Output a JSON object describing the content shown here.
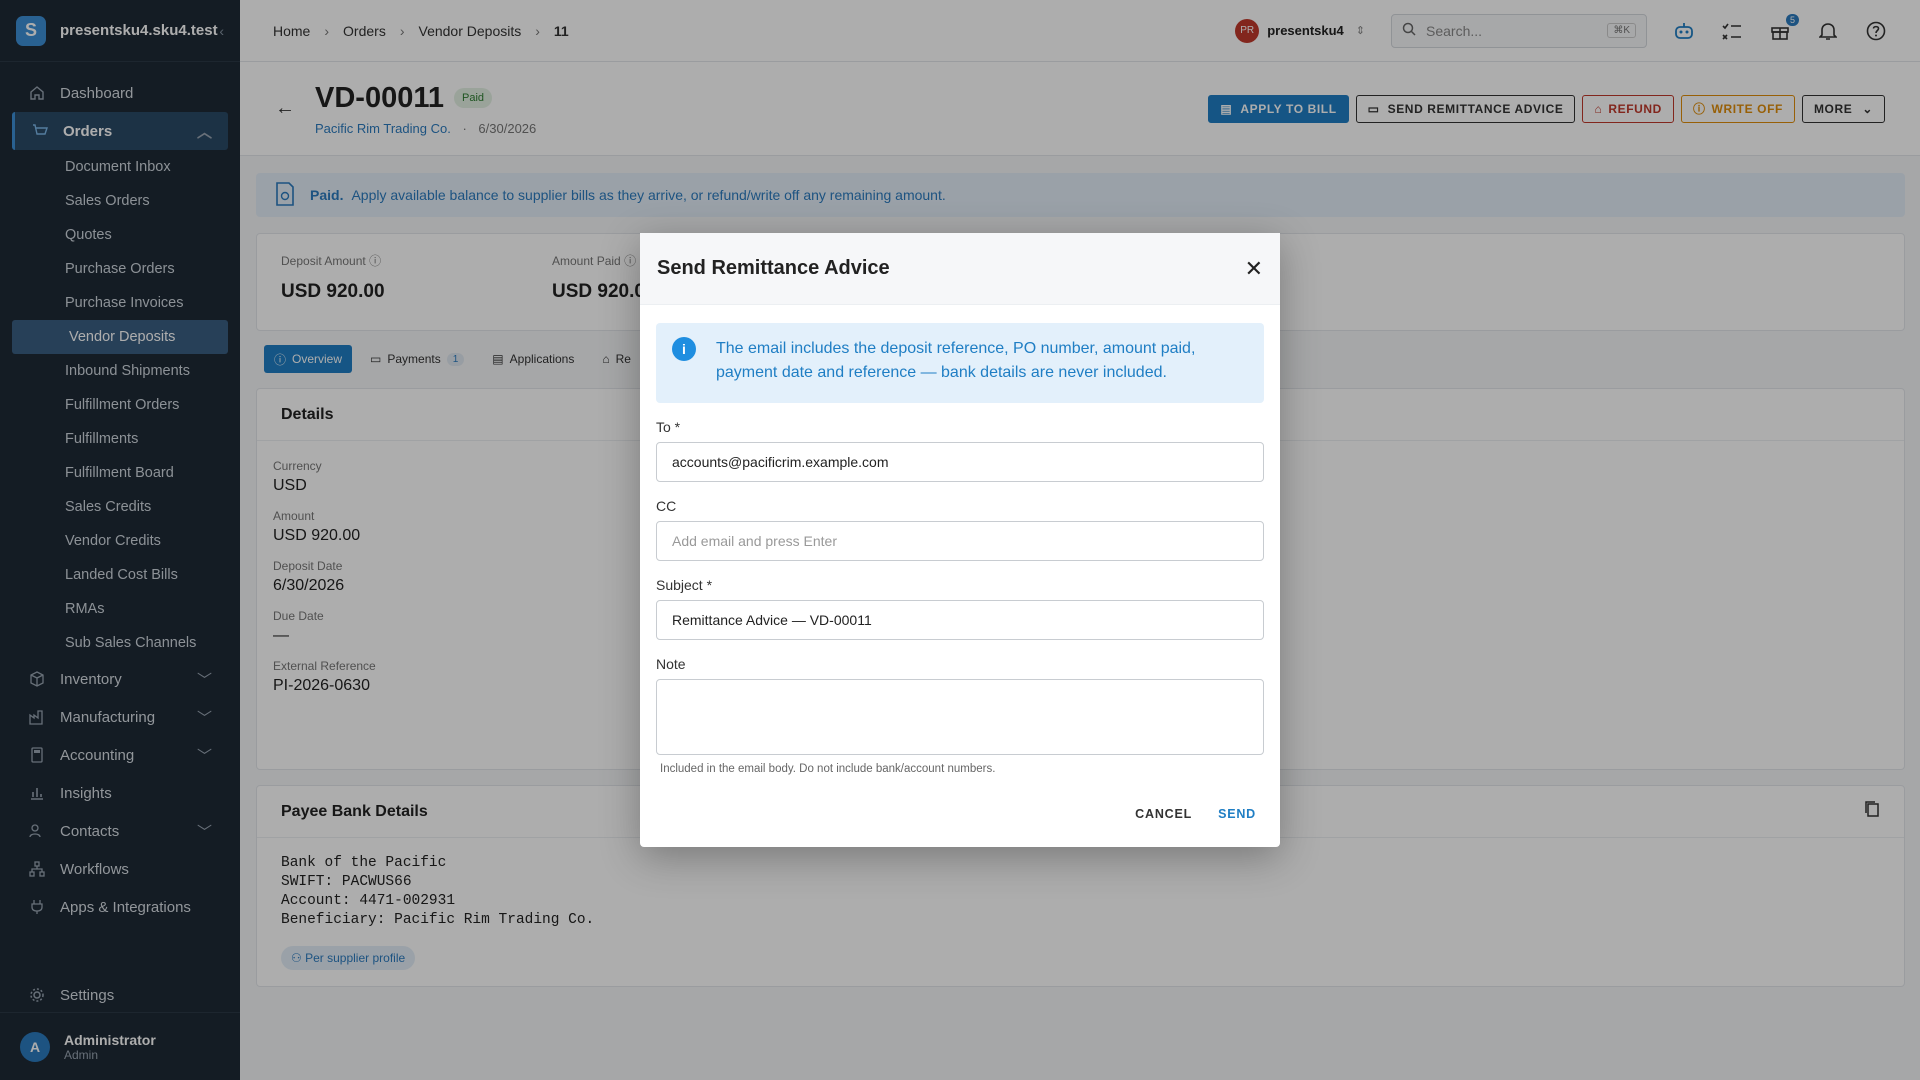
{
  "app": {
    "org": "presentsku4.sku4.test",
    "logo_letter": "S"
  },
  "sidebar": {
    "items": [
      {
        "label": "Dashboard"
      },
      {
        "label": "Orders"
      },
      {
        "label": "Inventory"
      },
      {
        "label": "Manufacturing"
      },
      {
        "label": "Accounting"
      },
      {
        "label": "Insights"
      },
      {
        "label": "Contacts"
      },
      {
        "label": "Workflows"
      },
      {
        "label": "Apps & Integrations"
      }
    ],
    "orders_sub": [
      "Document Inbox",
      "Sales Orders",
      "Quotes",
      "Purchase Orders",
      "Purchase Invoices",
      "Vendor Deposits",
      "Inbound Shipments",
      "Fulfillment Orders",
      "Fulfillments",
      "Fulfillment Board",
      "Sales Credits",
      "Vendor Credits",
      "Landed Cost Bills",
      "RMAs",
      "Sub Sales Channels"
    ],
    "settings": "Settings",
    "user": {
      "initial": "A",
      "name": "Administrator",
      "role": "Admin"
    }
  },
  "topbar": {
    "breadcrumbs": [
      "Home",
      "Orders",
      "Vendor Deposits",
      "11"
    ],
    "org_initials": "PR",
    "org_name": "presentsku4",
    "search_placeholder": "Search...",
    "search_shortcut": "⌘K",
    "gift_badge": "5"
  },
  "header": {
    "title": "VD-00011",
    "status": "Paid",
    "vendor": "Pacific Rim Trading Co.",
    "date": "6/30/2026",
    "actions": {
      "apply": "APPLY TO BILL",
      "remit": "SEND REMITTANCE ADVICE",
      "refund": "REFUND",
      "writeoff": "WRITE OFF",
      "more": "MORE"
    }
  },
  "banner": {
    "strong": "Paid.",
    "text": "Apply available balance to supplier bills as they arrive, or refund/write off any remaining amount."
  },
  "stats": [
    {
      "label": "Deposit Amount",
      "value": "USD 920.00"
    },
    {
      "label": "Amount Paid",
      "value": "USD 920.00"
    }
  ],
  "tabs": {
    "overview": "Overview",
    "payments": "Payments",
    "payments_count": "1",
    "applications": "Applications",
    "refunds": "Re"
  },
  "details": {
    "title": "Details",
    "fields": [
      {
        "label": "Currency",
        "value": "USD"
      },
      {
        "label": "Amount",
        "value": "USD 920.00"
      },
      {
        "label": "Deposit Date",
        "value": "6/30/2026"
      },
      {
        "label": "Due Date",
        "value": "—"
      },
      {
        "label": "External Reference",
        "value": "PI-2026-0630"
      }
    ]
  },
  "bank": {
    "title": "Payee Bank Details",
    "lines": "Bank of the Pacific\nSWIFT: PACWUS66\nAccount: 4471-002931\nBeneficiary: Pacific Rim Trading Co.",
    "chip": "Per supplier profile"
  },
  "modal": {
    "title": "Send Remittance Advice",
    "info": "The email includes the deposit reference, PO number, amount paid, payment date and reference — bank details are never included.",
    "to_label": "To *",
    "to_value": "accounts@pacificrim.example.com",
    "cc_label": "CC",
    "cc_placeholder": "Add email and press Enter",
    "subject_label": "Subject *",
    "subject_value": "Remittance Advice — VD-00011",
    "note_label": "Note",
    "note_hint": "Included in the email body. Do not include bank/account numbers.",
    "cancel": "CANCEL",
    "send": "SEND"
  }
}
